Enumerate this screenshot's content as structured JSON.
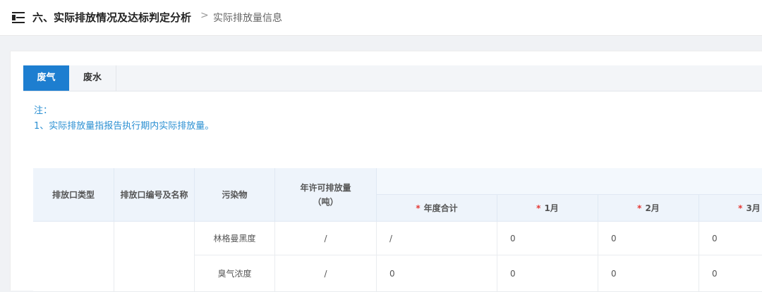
{
  "breadcrumb": {
    "title": "六、实际排放情况及达标判定分析",
    "separator": ">",
    "current": "实际排放量信息"
  },
  "tabs": [
    {
      "label": "废气",
      "active": true
    },
    {
      "label": "废水",
      "active": false
    }
  ],
  "notes": {
    "heading": "注：",
    "items": [
      "1、实际排放量指报告执行期内实际排放量。"
    ]
  },
  "table": {
    "headers": {
      "outlet_type": "排放口类型",
      "outlet_id_name": "排放口编号及名称",
      "pollutant": "污染物",
      "annual_permit": "年许可排放量（吨）",
      "required_mark": "*",
      "annual_total": "年度合计",
      "month1": "1月",
      "month2": "2月",
      "month3": "3月"
    },
    "rows": [
      {
        "pollutant": "林格曼黑度",
        "permit": "/",
        "total": "/",
        "m1": "0",
        "m2": "0",
        "m3": "0"
      },
      {
        "pollutant": "臭气浓度",
        "permit": "/",
        "total": "0",
        "m1": "0",
        "m2": "0",
        "m3": "0"
      }
    ]
  },
  "colors": {
    "accent": "#1d7ed0",
    "note_text": "#2a8fd2",
    "required": "#e53935"
  }
}
